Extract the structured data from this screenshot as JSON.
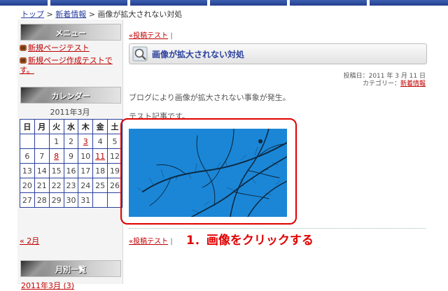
{
  "breadcrumb": {
    "home": "トップ",
    "sep1": ">",
    "category": "新着情報",
    "sep2": ">",
    "current": "画像が拡大されない対処"
  },
  "sidebar": {
    "menu_heading": "メニュー",
    "menu_items": [
      "新規ページテスト",
      "新規ページ作成テストです。"
    ],
    "calendar_heading": "カレンダー",
    "calendar_title": "2011年3月",
    "weekdays": [
      "日",
      "月",
      "火",
      "水",
      "木",
      "金",
      "土"
    ],
    "weeks": [
      [
        "",
        "",
        "1",
        "2",
        "3",
        "4",
        "5"
      ],
      [
        "6",
        "7",
        "8",
        "9",
        "10",
        "11",
        "12"
      ],
      [
        "13",
        "14",
        "15",
        "16",
        "17",
        "18",
        "19"
      ],
      [
        "20",
        "21",
        "22",
        "23",
        "24",
        "25",
        "26"
      ],
      [
        "27",
        "28",
        "29",
        "30",
        "31",
        "",
        ""
      ]
    ],
    "linked_days": [
      "3",
      "8",
      "11"
    ],
    "prev_month": "« 2月",
    "archive_heading": "月別一覧",
    "archive_item": "2011年3月 (3)"
  },
  "post": {
    "category_top": "«投稿テスト",
    "category_top_sep": "|",
    "title": "画像が拡大されない対処",
    "posted": "投稿日：2011 年 3 月 11 日",
    "category_label": "カテゴリー：",
    "category_name": "新着情報",
    "body1": "ブログにより画像が拡大されない事象が発生。",
    "body2": "テスト記事です。",
    "category_bottom": "«投稿テスト",
    "category_bottom_sep": "|"
  },
  "annotation": "1．画像をクリックする",
  "colors": {
    "link": "#c00000",
    "nav": "#2a3f9c",
    "annotation": "#e00000",
    "image_sky": "#1b86d6"
  }
}
